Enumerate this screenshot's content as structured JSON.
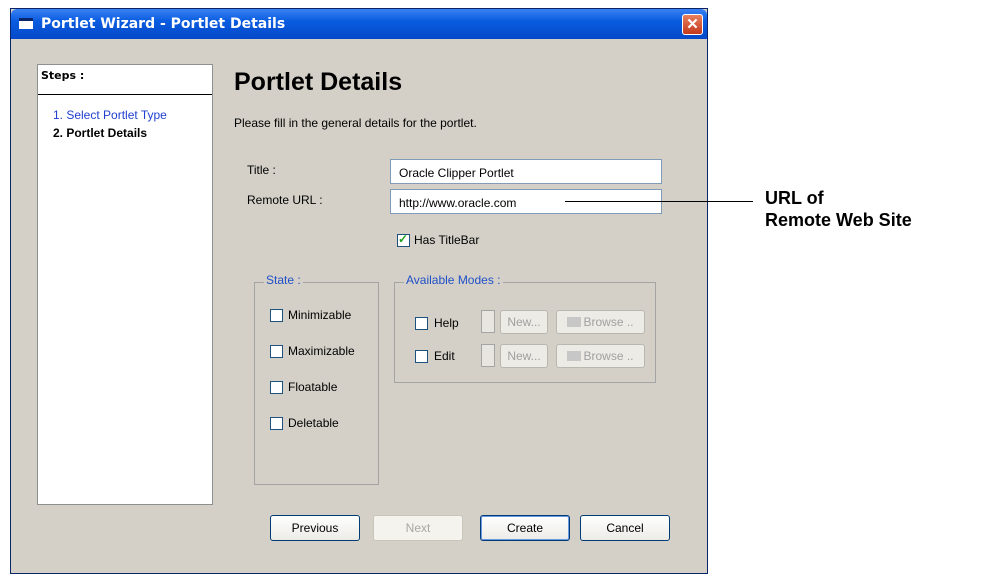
{
  "window": {
    "title": "Portlet Wizard - Portlet Details",
    "close_glyph": "✕"
  },
  "steps": {
    "heading": "Steps :",
    "items": [
      {
        "label": "1. Select Portlet Type"
      },
      {
        "label": "2. Portlet Details"
      }
    ]
  },
  "main": {
    "title": "Portlet Details",
    "intro": "Please fill in the general details for the portlet."
  },
  "form": {
    "title_label": "Title :",
    "title_value": "Oracle Clipper Portlet",
    "url_label": "Remote URL :",
    "url_value": "http://www.oracle.com",
    "has_titlebar_label": "Has TitleBar",
    "has_titlebar_checked": true
  },
  "state": {
    "legend": "State :",
    "options": [
      {
        "label": "Minimizable",
        "checked": false
      },
      {
        "label": "Maximizable",
        "checked": false
      },
      {
        "label": "Floatable",
        "checked": false
      },
      {
        "label": "Deletable",
        "checked": false
      }
    ]
  },
  "modes": {
    "legend": "Available Modes :",
    "rows": [
      {
        "label": "Help",
        "checked": false,
        "new_label": "New...",
        "browse_label": "Browse .."
      },
      {
        "label": "Edit",
        "checked": false,
        "new_label": "New...",
        "browse_label": "Browse .."
      }
    ]
  },
  "buttons": {
    "previous": "Previous",
    "next": "Next",
    "create": "Create",
    "cancel": "Cancel"
  },
  "callout": {
    "line1": "URL of",
    "line2": "Remote Web Site"
  },
  "icons": {
    "window_icon": "window-icon",
    "close_icon": "close-icon",
    "check_icon": "check-icon",
    "folder_icon": "folder-open-icon"
  },
  "colors": {
    "titlebar": "#0a5ce0",
    "dialog_bg": "#d4d0c8",
    "step_link": "#2040d0",
    "legend": "#2050c8",
    "check": "#21a121"
  }
}
